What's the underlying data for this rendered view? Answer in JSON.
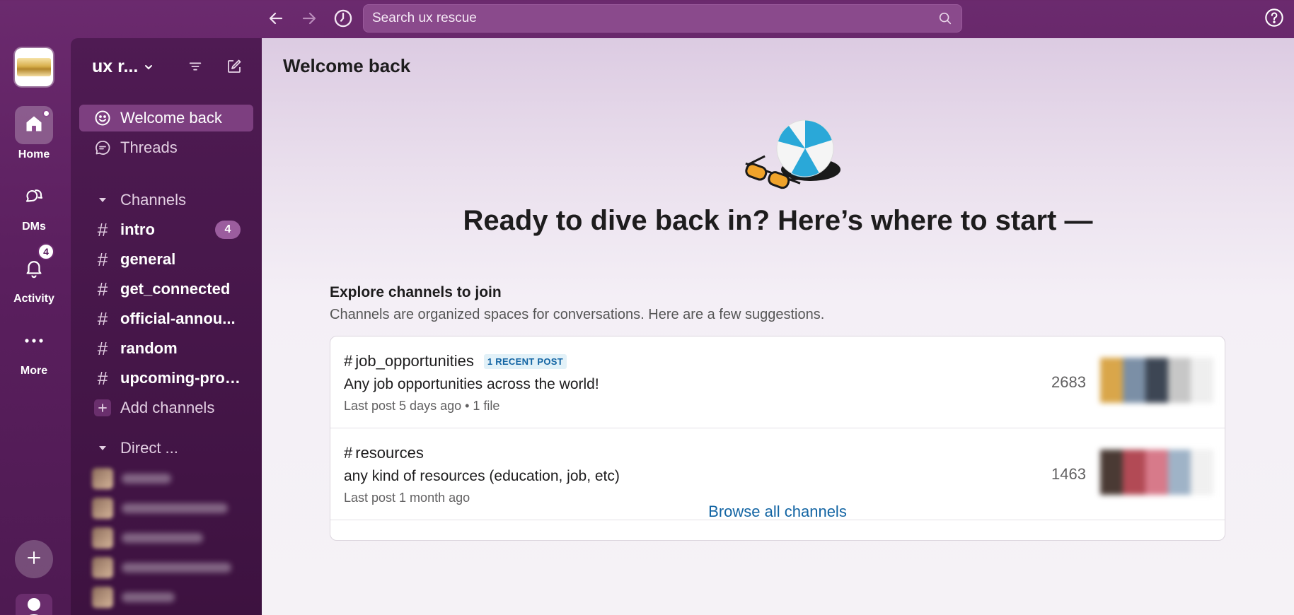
{
  "topbar": {
    "search_placeholder": "Search ux rescue",
    "back_icon": "arrow-left-icon",
    "forward_icon": "arrow-right-icon",
    "history_icon": "clock-icon",
    "help_icon": "question-circle-icon"
  },
  "rail": {
    "home_label": "Home",
    "dms_label": "DMs",
    "activity_label": "Activity",
    "activity_badge": "4",
    "more_label": "More"
  },
  "sidebar": {
    "workspace_name": "ux r...",
    "welcome_label": "Welcome back",
    "threads_label": "Threads",
    "channels_header": "Channels",
    "channels": [
      {
        "name": "intro",
        "count": "4"
      },
      {
        "name": "general"
      },
      {
        "name": "get_connected"
      },
      {
        "name": "official-annou..."
      },
      {
        "name": "random"
      },
      {
        "name": "upcoming-proj..."
      }
    ],
    "add_channels_label": "Add channels",
    "direct_header": "Direct ..."
  },
  "main": {
    "title": "Welcome back",
    "heading": "Ready to dive back in? Here’s where to start —",
    "explore_title": "Explore channels to join",
    "explore_subtitle": "Channels are organized spaces for conversations. Here are a few suggestions.",
    "channels": [
      {
        "hash": "#",
        "name": "job_opportunities",
        "badge": "1 RECENT POST",
        "description": "Any job opportunities across the world!",
        "meta": "Last post 5 days ago  •  1 file",
        "members": "2683"
      },
      {
        "hash": "#",
        "name": "resources",
        "badge": "",
        "description": "any kind of resources (education, job, etc)",
        "meta": "Last post 1 month ago",
        "members": "1463"
      }
    ],
    "browse_label": "Browse all channels"
  },
  "colors": {
    "aubergine": "#5a1f5e",
    "sidebar_bg": "#4f1b53",
    "active_row": "#7d3f80",
    "link_blue": "#1264a3",
    "presence_green": "#2bac76"
  }
}
